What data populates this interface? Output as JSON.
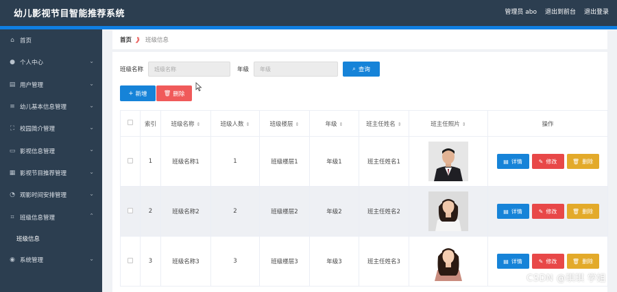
{
  "header": {
    "title": "幼儿影视节目智能推荐系统",
    "admin_label": "管理员 abo",
    "front_link": "退出到前台",
    "logout_link": "退出登录"
  },
  "sidebar": {
    "items": [
      {
        "label": "首页",
        "icon": "home-icon"
      },
      {
        "label": "个人中心",
        "icon": "user-icon"
      },
      {
        "label": "用户管理",
        "icon": "users-icon"
      },
      {
        "label": "幼儿基本信息管理",
        "icon": "list-icon"
      },
      {
        "label": "校园简介管理",
        "icon": "frame-icon"
      },
      {
        "label": "影视信息管理",
        "icon": "chat-icon"
      },
      {
        "label": "影视节目推荐管理",
        "icon": "doc-icon"
      },
      {
        "label": "观影时间安排管理",
        "icon": "clock-icon"
      },
      {
        "label": "班级信息管理",
        "icon": "crop-icon"
      },
      {
        "label": "系统管理",
        "icon": "pin-icon"
      }
    ],
    "submenu_active": "班级信息"
  },
  "breadcrumb": {
    "home": "首页",
    "separator": "》",
    "current": "班级信息"
  },
  "search": {
    "class_label": "班级名称",
    "class_placeholder": "班级名称",
    "grade_label": "年级",
    "grade_placeholder": "年级",
    "query_button": "查询"
  },
  "actions": {
    "add_button": "新增",
    "delete_button": "删除"
  },
  "table": {
    "headers": {
      "index": "索引",
      "class_name": "班级名称",
      "class_count": "班级人数",
      "class_floor": "班级楼层",
      "grade": "年级",
      "teacher_name": "班主任姓名",
      "teacher_photo": "班主任照片",
      "operation": "操作"
    },
    "rows": [
      {
        "index": "1",
        "class_name": "班级名称1",
        "class_count": "1",
        "class_floor": "班级楼层1",
        "grade": "年级1",
        "teacher_name": "班主任姓名1"
      },
      {
        "index": "2",
        "class_name": "班级名称2",
        "class_count": "2",
        "class_floor": "班级楼层2",
        "grade": "年级2",
        "teacher_name": "班主任姓名2"
      },
      {
        "index": "3",
        "class_name": "班级名称3",
        "class_count": "3",
        "class_floor": "班级楼层3",
        "grade": "年级3",
        "teacher_name": "班主任姓名3"
      }
    ],
    "op_labels": {
      "detail": "详情",
      "edit": "修改",
      "delete": "删除"
    }
  },
  "watermark": "CSDN @琪琪 学姐",
  "colors": {
    "topbar": "#2c3e50",
    "accent_blue": "#1683d8",
    "danger_red": "#e84848",
    "warning_yellow": "#e3aa2a"
  }
}
